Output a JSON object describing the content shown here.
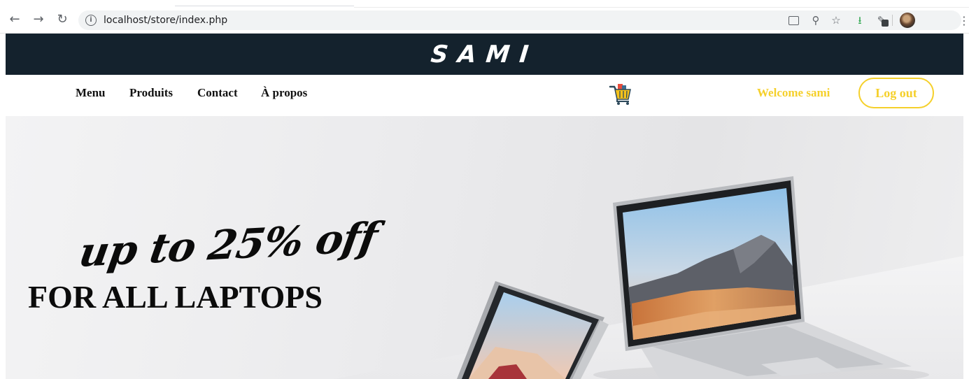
{
  "browser": {
    "url": "localhost/store/index.php",
    "icons": [
      "back-icon",
      "forward-icon",
      "reload-icon",
      "info-icon",
      "translate-icon",
      "zoom-icon",
      "star-icon",
      "save-icon",
      "pen-extension-icon",
      "profile-avatar",
      "menu-kebab-icon"
    ]
  },
  "site": {
    "brand": "SAMI",
    "nav": {
      "menu": "Menu",
      "produits": "Produits",
      "contact": "Contact",
      "apropos": "À propos"
    },
    "cart_icon": "shopping-cart-icon",
    "welcome": "Welcome sami",
    "logout_label": "Log out"
  },
  "hero": {
    "promo_line1": "up to 25% off",
    "promo_line2": "FOR ALL LAPTOPS"
  },
  "colors": {
    "header_bg": "#14222d",
    "accent_yellow": "#f5d02b",
    "text_dark": "#111111"
  }
}
